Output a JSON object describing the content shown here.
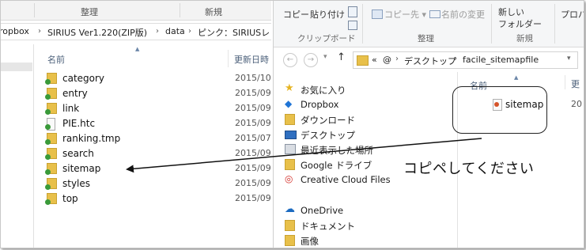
{
  "left_window": {
    "ribbon": {
      "group_organize": "整理",
      "group_new": "新規"
    },
    "address": {
      "crumbs": [
        "ropbox",
        "SIRIUS Ver1.220(ZIP版)",
        "data",
        "ピンク：SIRIUSレ"
      ]
    },
    "columns": {
      "name": "名前",
      "modified": "更新日時"
    },
    "files": [
      {
        "name": "category",
        "date": "2015/10",
        "type": "folder"
      },
      {
        "name": "entry",
        "date": "2015/09",
        "type": "folder"
      },
      {
        "name": "link",
        "date": "2015/09",
        "type": "folder"
      },
      {
        "name": "PIE.htc",
        "date": "2015/09",
        "type": "file"
      },
      {
        "name": "ranking.tmp",
        "date": "2015/07",
        "type": "folder"
      },
      {
        "name": "search",
        "date": "2015/09",
        "type": "folder"
      },
      {
        "name": "sitemap",
        "date": "2015/09",
        "type": "folder"
      },
      {
        "name": "styles",
        "date": "2015/09",
        "type": "folder"
      },
      {
        "name": "top",
        "date": "2015/09",
        "type": "folder"
      }
    ]
  },
  "right_window": {
    "ribbon": {
      "copy": "コピー",
      "paste": "貼り付け",
      "clipboard_group": "クリップボード",
      "copy_to": "コピー先",
      "rename": "名前の変更",
      "organize_group": "整理",
      "new_folder_line1": "新しい",
      "new_folder_line2": "フォルダー",
      "new_group": "新規",
      "properties": "プロパ"
    },
    "address": {
      "lead": "«",
      "crumbs": [
        "@",
        "デスクトップ",
        "facile_sitemapfile"
      ]
    },
    "nav_items": [
      {
        "label": "お気に入り",
        "icon": "star-icon"
      },
      {
        "label": "Dropbox",
        "icon": "dropbox-icon"
      },
      {
        "label": "ダウンロード",
        "icon": "download-folder-icon"
      },
      {
        "label": "デスクトップ",
        "icon": "desktop-icon"
      },
      {
        "label": "最近表示した場所",
        "icon": "recent-places-icon"
      },
      {
        "label": "Google ドライブ",
        "icon": "google-drive-folder-icon"
      },
      {
        "label": "Creative Cloud Files",
        "icon": "creative-cloud-icon"
      },
      {
        "label": "OneDrive",
        "icon": "onedrive-icon"
      },
      {
        "label": "ドキュメント",
        "icon": "documents-folder-icon"
      },
      {
        "label": "画像",
        "icon": "pictures-folder-icon"
      }
    ],
    "columns": {
      "name": "名前",
      "modified": "更"
    },
    "files": [
      {
        "name": "sitemap",
        "date": "20"
      }
    ]
  },
  "annotation": {
    "text": "コピペしてください"
  },
  "colors": {
    "folder": "#e8c04a",
    "accent_green": "#3a9a3a",
    "arrow": "#111111"
  }
}
